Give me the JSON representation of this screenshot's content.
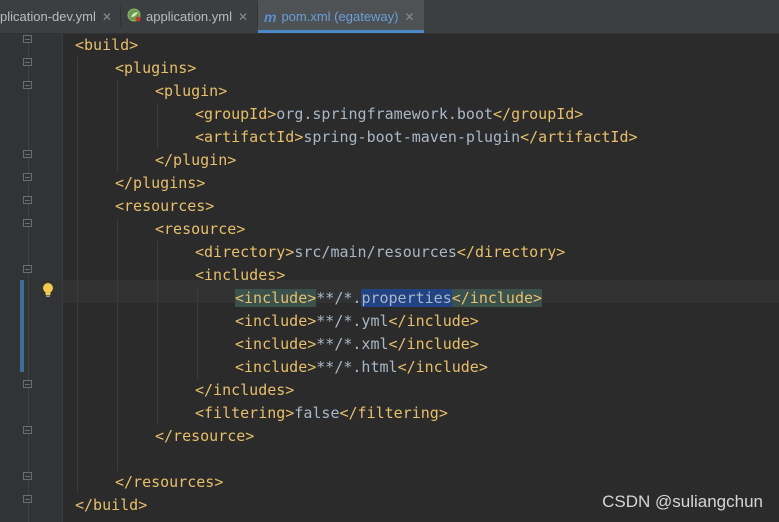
{
  "tabs": [
    {
      "label": "plication-dev.yml",
      "close": "✕",
      "icon": "yaml-icon",
      "active": false
    },
    {
      "label": "application.yml",
      "close": "✕",
      "icon": "spring-leaf-icon",
      "active": false
    },
    {
      "label": "pom.xml (egateway)",
      "close": "✕",
      "icon": "maven-m-icon",
      "icon_glyph": "m",
      "active": true
    }
  ],
  "code": {
    "lines": [
      {
        "indent": 0,
        "open": "<build>"
      },
      {
        "indent": 1,
        "open": "<plugins>"
      },
      {
        "indent": 2,
        "open": "<plugin>"
      },
      {
        "indent": 3,
        "open": "<groupId>",
        "text": "org.springframework.boot",
        "close": "</groupId>"
      },
      {
        "indent": 3,
        "open": "<artifactId>",
        "text": "spring-boot-maven-plugin",
        "close": "</artifactId>"
      },
      {
        "indent": 2,
        "open": "</plugin>"
      },
      {
        "indent": 1,
        "open": "</plugins>"
      },
      {
        "indent": 1,
        "open": "<resources>"
      },
      {
        "indent": 2,
        "open": "<resource>"
      },
      {
        "indent": 3,
        "open": "<directory>",
        "text": "src/main/resources",
        "close": "</directory>"
      },
      {
        "indent": 3,
        "open": "<includes>"
      },
      {
        "indent": 4,
        "open": "<include>",
        "text_pre": "**/*.",
        "text_sel": "properties",
        "close": "</include>",
        "current": true
      },
      {
        "indent": 4,
        "open": "<include>",
        "text": "**/*.yml",
        "close": "</include>"
      },
      {
        "indent": 4,
        "open": "<include>",
        "text": "**/*.xml",
        "close": "</include>"
      },
      {
        "indent": 4,
        "open": "<include>",
        "text": "**/*.html",
        "close": "</include>"
      },
      {
        "indent": 3,
        "open": "</includes>"
      },
      {
        "indent": 3,
        "open": "<filtering>",
        "text": "false",
        "close": "</filtering>"
      },
      {
        "indent": 2,
        "open": "</resource>"
      },
      {
        "indent": 0,
        "blank": true
      },
      {
        "indent": 1,
        "open": "</resources>"
      },
      {
        "indent": 0,
        "open": "</build>"
      }
    ]
  },
  "gutter": {
    "bulb_icon": "lightbulb-icon"
  },
  "watermark": "CSDN @suliangchun",
  "colors": {
    "background": "#2b2b2b",
    "tag": "#e8bf6a",
    "text": "#a9b7c6",
    "active_tab_text": "#6a9fd8",
    "selection": "#214283",
    "tag_match": "#3b514d"
  }
}
